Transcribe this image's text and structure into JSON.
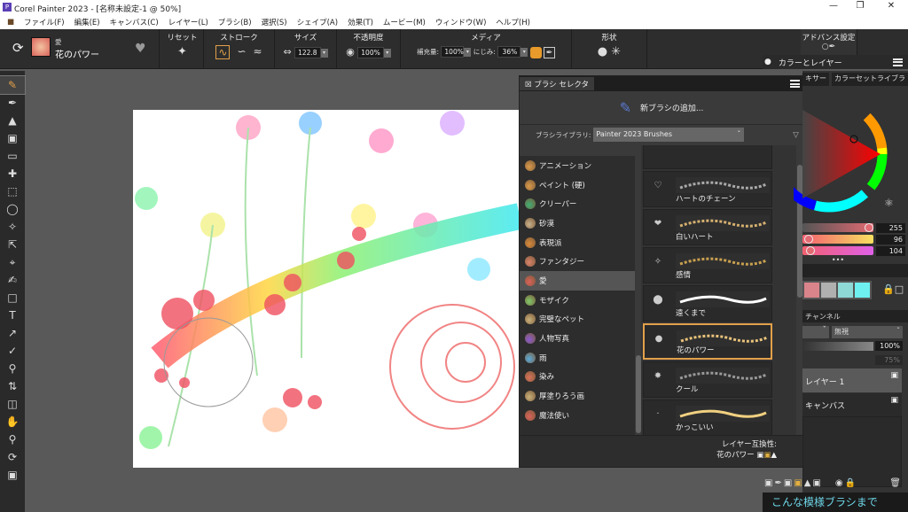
{
  "window": {
    "title": "Corel Painter 2023 - [名称未設定-1 @ 50%]",
    "logo": "P",
    "controls": [
      "minimize-icon",
      "restore-icon",
      "close-icon"
    ]
  },
  "menu": [
    "ファイル(F)",
    "編集(E)",
    "キャンバス(C)",
    "レイヤー(L)",
    "ブラシ(B)",
    "選択(S)",
    "シェイプ(A)",
    "効果(T)",
    "ムービー(M)",
    "ウィンドウ(W)",
    "ヘルプ(H)"
  ],
  "toolbar": {
    "brush_category": "愛",
    "brush_variant": "花のパワー",
    "reset_label": "リセット",
    "stroke_label": "ストローク",
    "size_label": "サイズ",
    "size_value": "122.8",
    "opacity_label": "不透明度",
    "opacity_value": "100%",
    "media_label": "メディア",
    "resaturation_label": "補充量:",
    "resaturation_value": "100%",
    "bleed_label": "にじみ:",
    "bleed_value": "36%",
    "shape_label": "形状",
    "advanced_label": "アドバンス設定"
  },
  "brush_selector": {
    "tab": "ブラシ セレクタ",
    "add_brush": "新ブラシの追加...",
    "library_label": "ブラシライブラリ:",
    "library_value": "Painter 2023 Brushes",
    "categories": [
      {
        "label": "アニメーション",
        "color": "#d99a4a"
      },
      {
        "label": "ペイント (硬)",
        "color": "#d99a4a"
      },
      {
        "label": "クリーパー",
        "color": "#3fae74"
      },
      {
        "label": "砂漠",
        "color": "#c9b08a"
      },
      {
        "label": "表現派",
        "color": "#d98a3a"
      },
      {
        "label": "ファンタジー",
        "color": "#d9826a"
      },
      {
        "label": "愛",
        "color": "#d9625a"
      },
      {
        "label": "モザイク",
        "color": "#7fc86a"
      },
      {
        "label": "完璧なペット",
        "color": "#c9b07a"
      },
      {
        "label": "人物写真",
        "color": "#8a5ad0"
      },
      {
        "label": "雨",
        "color": "#5aaad9"
      },
      {
        "label": "染み",
        "color": "#d9725a"
      },
      {
        "label": "厚塗りろう画",
        "color": "#c9b07a"
      },
      {
        "label": "魔法使い",
        "color": "#d9625a"
      }
    ],
    "selected_category": "愛",
    "variants": [
      "ハートのチェーン",
      "白いハート",
      "感情",
      "遠くまで",
      "花のパワー",
      "クール",
      "かっこいい"
    ],
    "selected_variant": "花のパワー",
    "layer_compat_label": "レイヤー互換性:",
    "layer_compat_value": "花のパワー"
  },
  "color_layers": {
    "title": "カラーとレイヤー",
    "tabs": [
      "キサー",
      "カラーセットライブラ"
    ],
    "rgb": [
      "255",
      "96",
      "104"
    ],
    "swatches": [
      "#d9848a",
      "#b0b0b0",
      "#8ed8d6",
      "#6ef0f0"
    ],
    "channel_tab": "チャンネル",
    "composite": "無視",
    "opacity": "100%",
    "grain": "75%",
    "layers": [
      {
        "name": "レイヤー 1",
        "selected": true
      },
      {
        "name": "キャンバス",
        "selected": false
      }
    ]
  },
  "caption": "こんな模様ブラシまで"
}
